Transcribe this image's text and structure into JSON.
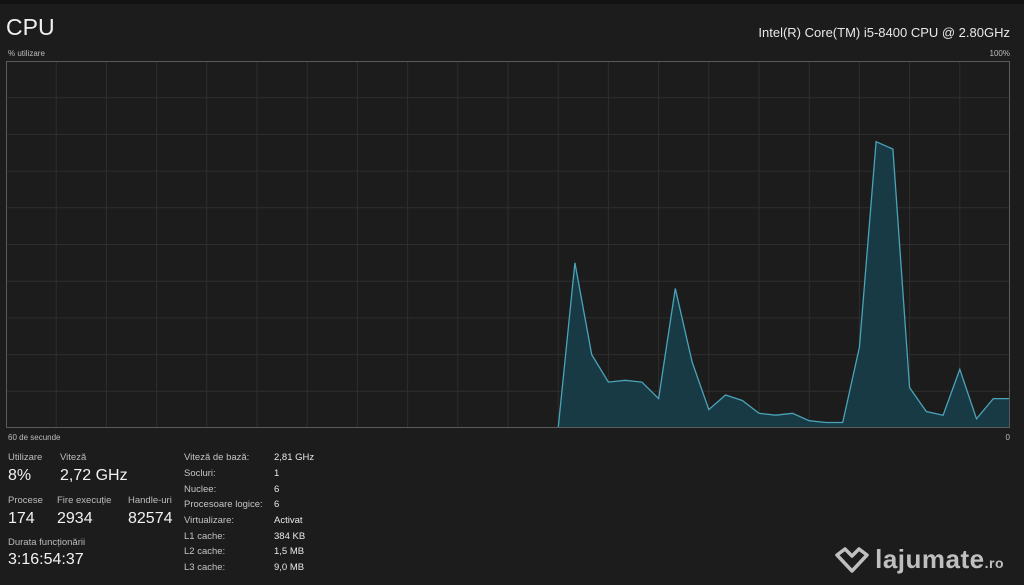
{
  "header": {
    "title": "CPU",
    "cpu_model": "Intel(R) Core(TM) i5-8400 CPU @ 2.80GHz"
  },
  "graph": {
    "y_label": "% utilizare",
    "y_max_label": "100%",
    "x_label": "60 de secunde",
    "x_min_label": "0"
  },
  "chart_data": {
    "type": "area",
    "x_unit": "seconds ago",
    "ylim": [
      0,
      100
    ],
    "grid": true,
    "x": [
      60,
      59,
      58,
      57,
      56,
      55,
      54,
      53,
      52,
      51,
      50,
      49,
      48,
      47,
      46,
      45,
      44,
      43,
      42,
      41,
      40,
      39,
      38,
      37,
      36,
      35,
      34,
      33,
      32,
      31,
      30,
      29,
      28,
      27,
      26,
      25,
      24,
      23,
      22,
      21,
      20,
      19,
      18,
      17,
      16,
      15,
      14,
      13,
      12,
      11,
      10,
      9,
      8,
      7,
      6,
      5,
      4,
      3,
      2,
      1,
      0
    ],
    "values": [
      0,
      0,
      0,
      0,
      0,
      0,
      0,
      0,
      0,
      0,
      0,
      0,
      0,
      0,
      0,
      0,
      0,
      0,
      0,
      0,
      0,
      0,
      0,
      0,
      0,
      0,
      0,
      0,
      0,
      0,
      0,
      0,
      0,
      0,
      45,
      20,
      12.5,
      13,
      12.5,
      8,
      38,
      18,
      5,
      9,
      7.5,
      4,
      3.5,
      4,
      2,
      1.5,
      1.5,
      22,
      78,
      76,
      11,
      4.5,
      3.5,
      16,
      2.5,
      8,
      8
    ]
  },
  "stats": {
    "utilization": {
      "label": "Utilizare",
      "value": "8%"
    },
    "speed": {
      "label": "Viteză",
      "value": "2,72 GHz"
    },
    "processes": {
      "label": "Procese",
      "value": "174"
    },
    "threads": {
      "label": "Fire execuție",
      "value": "2934"
    },
    "handles": {
      "label": "Handle-uri",
      "value": "82574"
    },
    "uptime": {
      "label": "Durata funcționării",
      "value": "3:16:54:37"
    }
  },
  "details": [
    {
      "key": "Viteză de bază:",
      "value": "2,81 GHz"
    },
    {
      "key": "Socluri:",
      "value": "1"
    },
    {
      "key": "Nuclee:",
      "value": "6"
    },
    {
      "key": "Procesoare logice:",
      "value": "6"
    },
    {
      "key": "Virtualizare:",
      "value": "Activat"
    },
    {
      "key": "L1 cache:",
      "value": "384 KB"
    },
    {
      "key": "L2 cache:",
      "value": "1,5 MB"
    },
    {
      "key": "L3 cache:",
      "value": "9,0 MB"
    }
  ],
  "watermark": {
    "text": "lajumate",
    "suffix": ".ro",
    "icon": "heart-hands-icon"
  },
  "colors": {
    "background": "#1c1c1c",
    "graph_line": "#4aa3b8",
    "graph_fill": "#173a45",
    "grid": "#2e2e2e",
    "graph_border": "#5a5a5a"
  }
}
